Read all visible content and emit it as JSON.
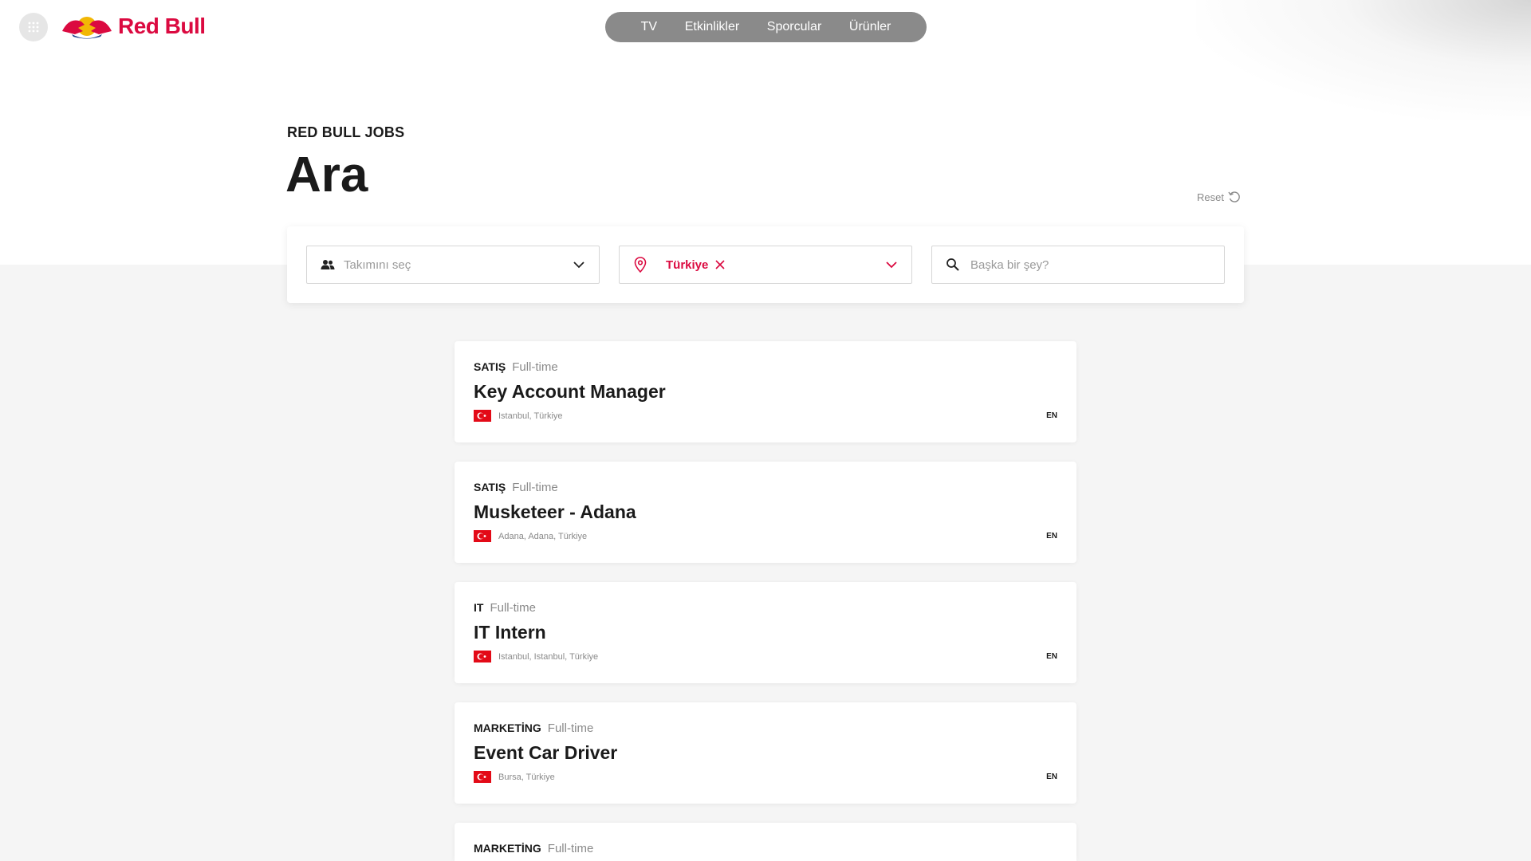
{
  "header": {
    "logo_text": "Red Bull",
    "nav": [
      "TV",
      "Etkinlikler",
      "Sporcular",
      "Ürünler"
    ]
  },
  "page": {
    "eyebrow": "RED BULL JOBS",
    "title": "Ara",
    "reset_label": "Reset"
  },
  "filters": {
    "team_placeholder": "Takımını seç",
    "location_selected": "Türkiye",
    "search_placeholder": "Başka bir şey?"
  },
  "jobs": [
    {
      "team": "SATIŞ",
      "type": "Full-time",
      "title": "Key Account Manager",
      "location": "Istanbul, Türkiye",
      "lang": "EN"
    },
    {
      "team": "SATIŞ",
      "type": "Full-time",
      "title": "Musketeer - Adana",
      "location": "Adana, Adana, Türkiye",
      "lang": "EN"
    },
    {
      "team": "IT",
      "type": "Full-time",
      "title": "IT Intern",
      "location": "Istanbul, Istanbul, Türkiye",
      "lang": "EN"
    },
    {
      "team": "MARKETİNG",
      "type": "Full-time",
      "title": "Event Car Driver",
      "location": "Bursa, Türkiye",
      "lang": "EN"
    },
    {
      "team": "MARKETİNG",
      "type": "Full-time"
    }
  ],
  "colors": {
    "brand": "#db0a40",
    "nav_pill": "#8a8a8a",
    "flag_red": "#e30a17"
  }
}
